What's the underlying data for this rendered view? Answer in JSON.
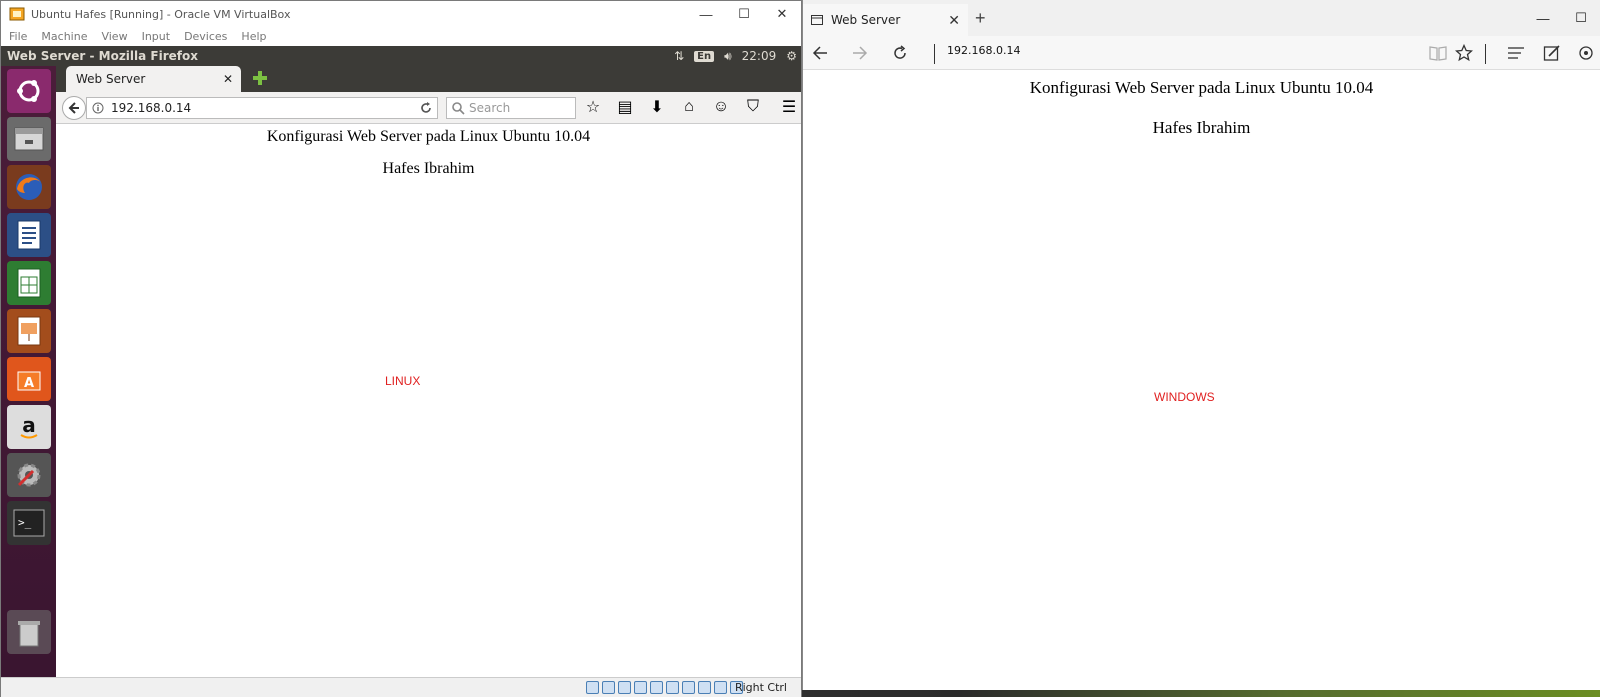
{
  "vbox": {
    "title": "Ubuntu Hafes [Running] - Oracle VM VirtualBox",
    "menu": [
      "File",
      "Machine",
      "View",
      "Input",
      "Devices",
      "Help"
    ],
    "status_right": "Right Ctrl"
  },
  "ubuntu_panel": {
    "window_title": "Web Server - Mozilla Firefox",
    "keyboard": "En",
    "time": "22:09"
  },
  "firefox": {
    "tab_label": "Web Server",
    "url": "192.168.0.14",
    "search_placeholder": "Search",
    "page": {
      "heading": "Konfigurasi Web Server pada Linux Ubuntu 10.04",
      "author": "Hafes Ibrahim",
      "os_label": "LINUX"
    }
  },
  "edge": {
    "tab_label": "Web Server",
    "url": "192.168.0.14",
    "page": {
      "heading": "Konfigurasi Web Server pada Linux Ubuntu 10.04",
      "author": "Hafes Ibrahim",
      "os_label": "WINDOWS"
    }
  },
  "colors": {
    "ubuntu_panel": "#3c3b37",
    "launcher": "#4b1d3a",
    "page_mark": "#e02020"
  }
}
